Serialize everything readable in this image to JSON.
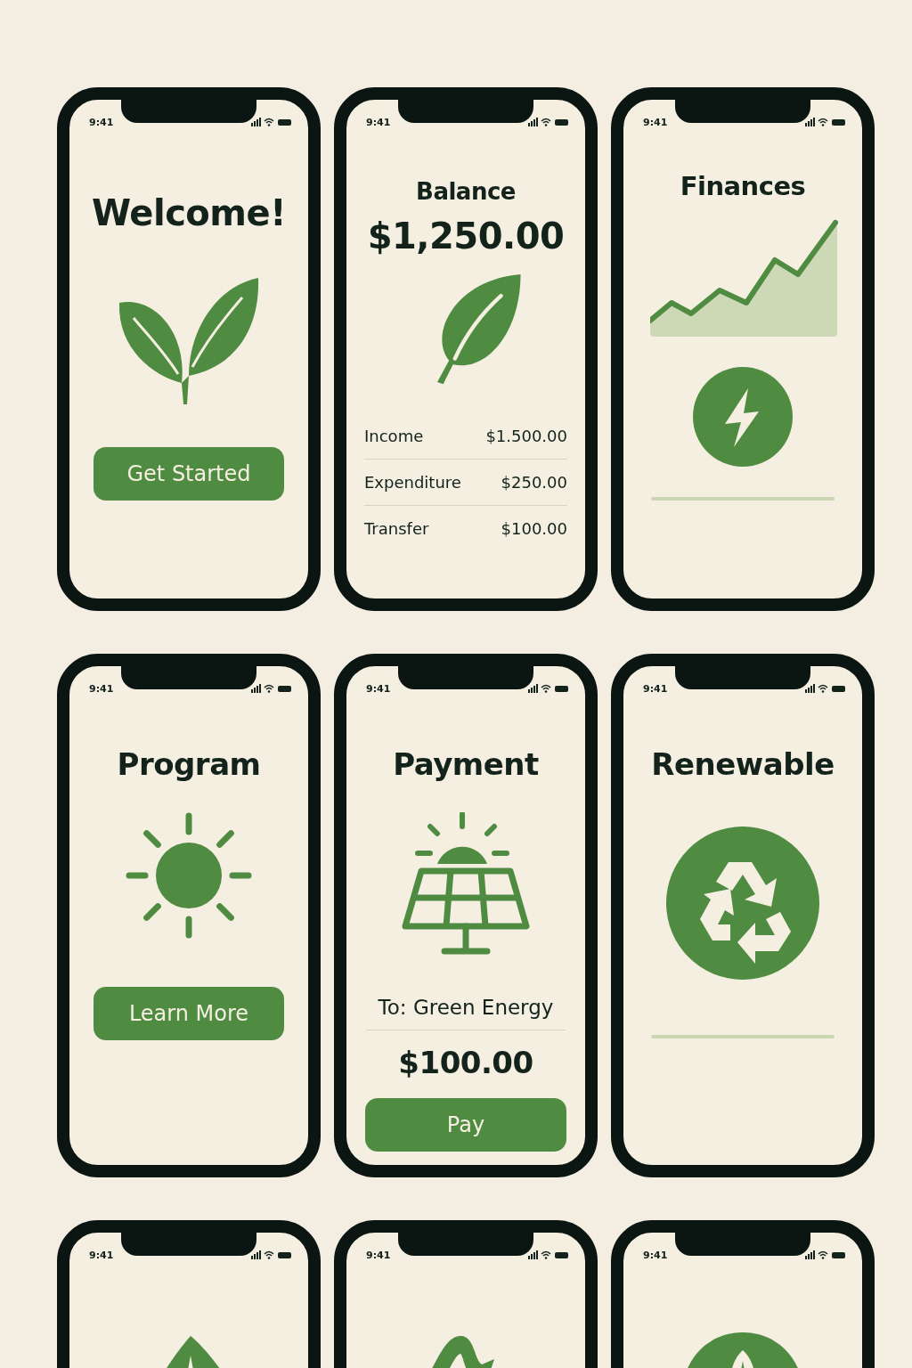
{
  "screens": [
    {
      "kind": "welcome",
      "time": "9:41",
      "title": "Welcome!",
      "button": "Get Started"
    },
    {
      "kind": "balance",
      "time": "9:41",
      "title": "Balance",
      "amount": "$1,250.00",
      "rows": [
        {
          "label": "Income",
          "value": "$1.500.00"
        },
        {
          "label": "Expenditure",
          "value": "$250.00"
        },
        {
          "label": "Transfer",
          "value": "$100.00"
        }
      ]
    },
    {
      "kind": "finances",
      "time": "9:41",
      "title": "Finances"
    },
    {
      "kind": "program",
      "time": "9:41",
      "title": "Program",
      "button": "Learn More"
    },
    {
      "kind": "payment",
      "time": "9:41",
      "title": "Payment",
      "recipient": "To: Green Energy",
      "amount": "$100.00",
      "button": "Pay"
    },
    {
      "kind": "renewable",
      "time": "9:41",
      "title": "Renewable"
    },
    {
      "kind": "leaf",
      "time": "9:41"
    },
    {
      "kind": "loop",
      "time": "9:41"
    },
    {
      "kind": "badge",
      "time": "9:41"
    }
  ]
}
